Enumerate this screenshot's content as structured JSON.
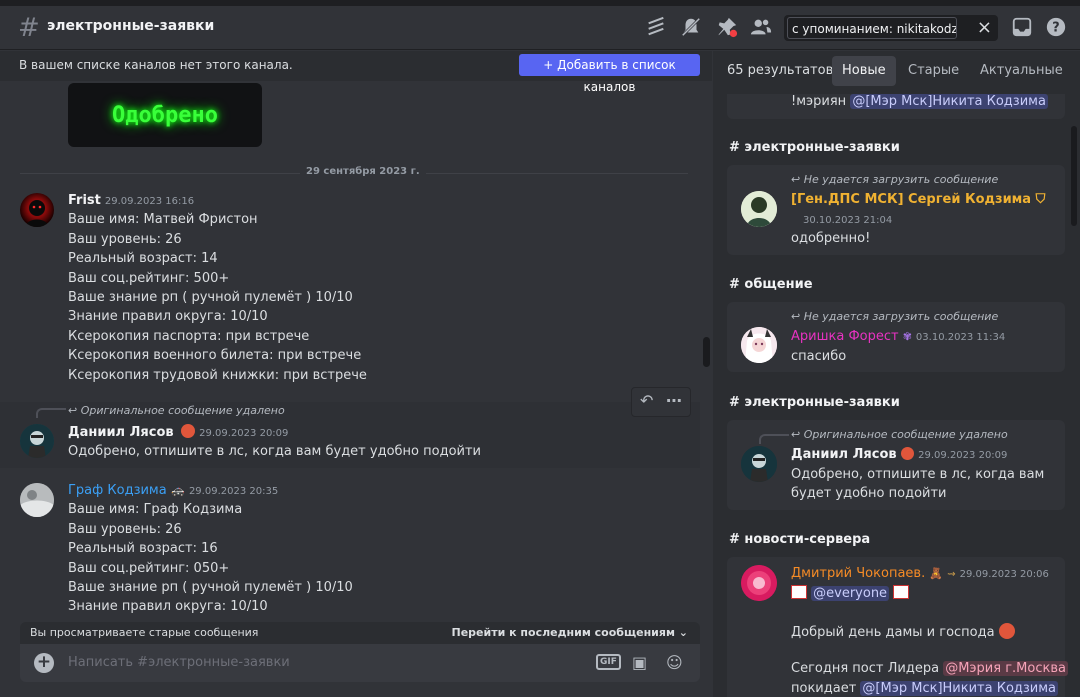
{
  "topbar": {
    "channel": "электронные-заявки",
    "search_value": "с упоминанием: nikitakodzima"
  },
  "notice": {
    "text": "В вашем списке каналов нет этого канала.",
    "button": "+ Добавить в список каналов"
  },
  "chat": {
    "image_text": "Одобрено",
    "date_divider": "29 сентября 2023 г.",
    "msg1": {
      "author": "Frist",
      "time": "29.09.2023 16:16",
      "lines": [
        "Ваше имя: Матвей Фристон",
        "Ваш уровень: 26",
        "Реальный возраст: 14",
        "Ваш соц.рейтинг: 500+",
        "Ваше знание рп ( ручной пулемёт ) 10/10",
        "Знание правил округа: 10/10",
        "Ксерокопия паспорта: при встрече",
        "Ксерокопия военного билета: при встрече",
        "Ксерокопия трудовой книжки: при встрече"
      ]
    },
    "msg2": {
      "reply": "Оригинальное сообщение удалено",
      "author": "Даниил Лясов",
      "time": "29.09.2023 20:09",
      "text": "Одобрено, отпишите в лс, когда вам будет удобно подойти"
    },
    "msg3": {
      "author": "Граф Кодзима",
      "time": "29.09.2023 20:35",
      "lines": [
        "Ваше имя: Граф Кодзима",
        "Ваш уровень: 26",
        "Реальный возраст: 16",
        "Ваш соц.рейтинг: 050+",
        "Ваше знание рп ( ручной пулемёт ) 10/10",
        "Знание правил округа: 10/10"
      ]
    },
    "old_notice": "Вы просматриваете старые сообщения",
    "jump_label": "Перейти к последним сообщениям",
    "composer_placeholder": "Написать #электронные-заявки",
    "gif_label": "GIF"
  },
  "panel": {
    "count": "65 результатов",
    "tabs": [
      "Новые",
      "Старые",
      "Актуальные"
    ],
    "r0_text": "!мэриян",
    "r0_mention": "@[Мэр Мск]Никита Кодзима",
    "r1": {
      "channel": "# электронные-заявки",
      "ref": "Не удается загрузить сообщение",
      "author": "[Ген.ДПС МСК] Сергей Кодзима",
      "time": "30.10.2023 21:04",
      "text": "одобренно!"
    },
    "r2": {
      "channel": "# общение",
      "ref": "Не удается загрузить сообщение",
      "author": "Аришка Форест",
      "time": "03.10.2023 11:34",
      "text": "спасибо"
    },
    "r3": {
      "channel": "# электронные-заявки",
      "ref": "Оригинальное сообщение удалено",
      "author": "Даниил Лясов",
      "time": "29.09.2023 20:09",
      "text1": "Одобрено, отпишите в лс, когда вам",
      "text2": "будет удобно подойти"
    },
    "r4": {
      "channel": "# новости-сервера",
      "author": "Дмитрий Чокопаев.",
      "time": "29.09.2023 20:06",
      "everyone": "@everyone",
      "text1": "Добрый день дамы и господа",
      "text2": "Сегодня пост Лидера",
      "mention1": "@Мэрия г.Москва",
      "text3": "покидает",
      "mention2": "@[Мэр Мск]Никита Кодзима"
    }
  },
  "colors": {
    "blurple": "#5865f2",
    "graf_name": "#3ba0f6",
    "sergey_name": "#f0b232",
    "arishka_name": "#e832c2",
    "dmitry_name": "#f58b26"
  }
}
